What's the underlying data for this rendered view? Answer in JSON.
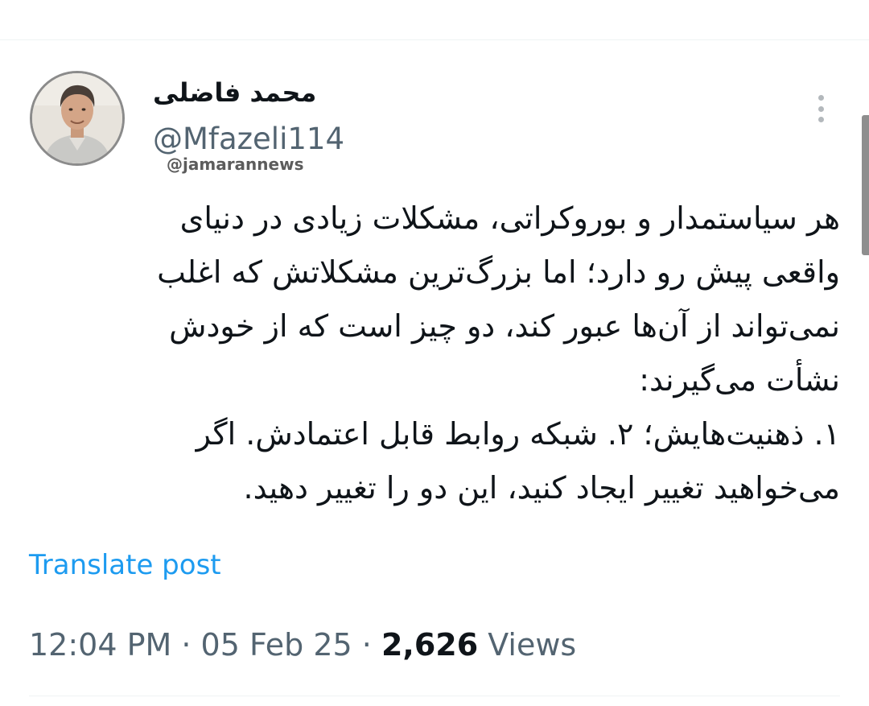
{
  "author": {
    "display_name": "محمد فاضلی",
    "handle": "@Mfazeli114"
  },
  "watermark": "@jamarannews",
  "tweet": {
    "lines": [
      "هر سیاستمدار و بوروکراتی، مشکلات زیادی در دنیای",
      "واقعی پیش رو دارد؛ اما بزرگ‌ترین مشکلاتش که اغلب",
      "نمی‌تواند از آن‌ها عبور کند، دو چیز است که از خودش",
      "نشأت می‌گیرند:",
      "۱. ذهنیت‌هایش؛ ۲. شبکه روابط قابل اعتمادش. اگر",
      "می‌خواهید تغییر ایجاد کنید، این دو را تغییر دهید."
    ]
  },
  "translate_label": "Translate post",
  "meta": {
    "time": "12:04 PM",
    "separator": " · ",
    "date": "05 Feb 25",
    "views_count": "2,626",
    "views_label": " Views"
  },
  "icons": {
    "more": "more-vertical-icon",
    "avatar": "profile-photo"
  },
  "colors": {
    "link": "#1d9bf0",
    "secondary_text": "#536471",
    "primary_text": "#0f1419",
    "divider": "#eff3f4"
  }
}
